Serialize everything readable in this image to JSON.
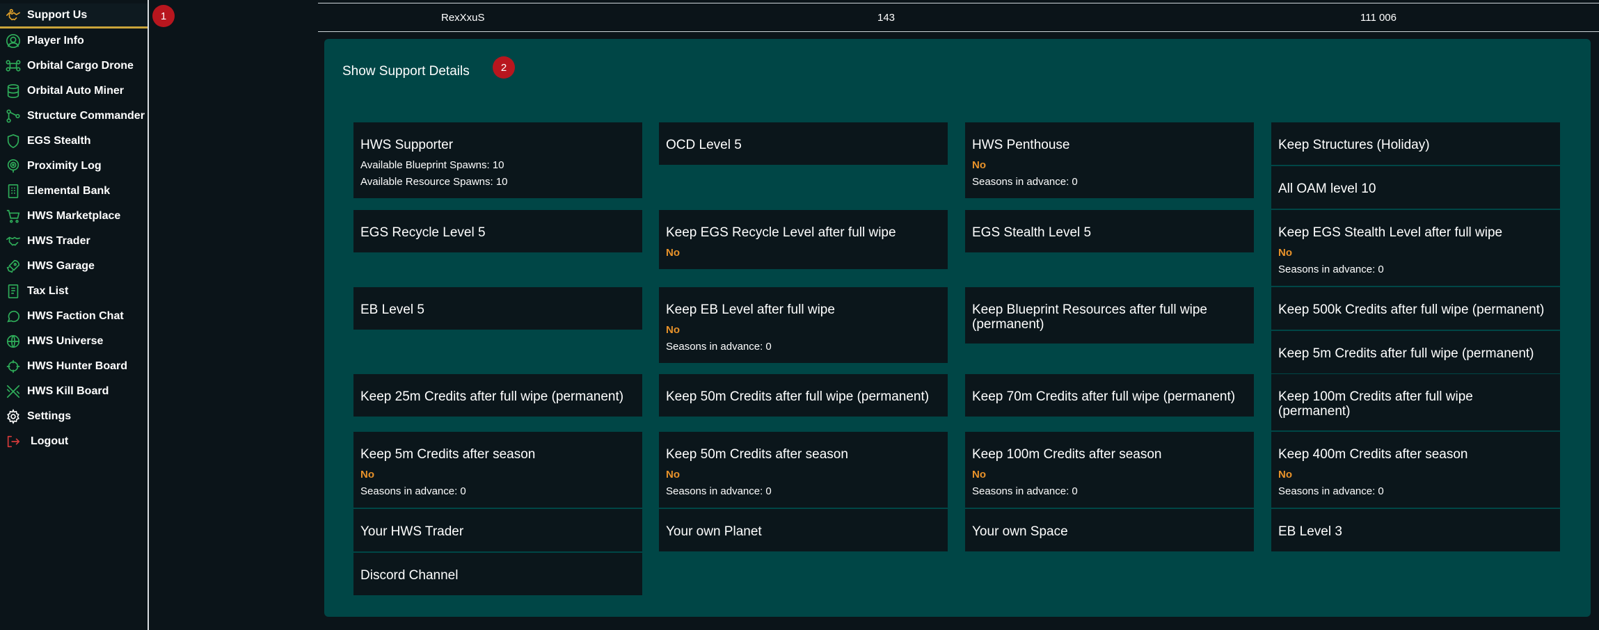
{
  "sidebar": {
    "items": [
      {
        "label": "Support Us",
        "icon": "handshake-icon"
      },
      {
        "label": "Player Info",
        "icon": "user-icon"
      },
      {
        "label": "Orbital Cargo Drone",
        "icon": "drone-icon"
      },
      {
        "label": "Orbital Auto Miner",
        "icon": "database-icon"
      },
      {
        "label": "Structure Commander",
        "icon": "network-icon"
      },
      {
        "label": "EGS Stealth",
        "icon": "shield-icon"
      },
      {
        "label": "Proximity Log",
        "icon": "radar-icon"
      },
      {
        "label": "Elemental Bank",
        "icon": "bank-icon"
      },
      {
        "label": "HWS Marketplace",
        "icon": "cart-icon"
      },
      {
        "label": "HWS Trader",
        "icon": "handshake-icon"
      },
      {
        "label": "HWS Garage",
        "icon": "rocket-icon"
      },
      {
        "label": "Tax List",
        "icon": "document-icon"
      },
      {
        "label": "HWS Faction Chat",
        "icon": "chat-icon"
      },
      {
        "label": "HWS Universe",
        "icon": "globe-icon"
      },
      {
        "label": "HWS Hunter Board",
        "icon": "crosshair-icon"
      },
      {
        "label": "HWS Kill Board",
        "icon": "kill-icon"
      },
      {
        "label": "Settings",
        "icon": "gear-icon"
      },
      {
        "label": "Logout",
        "icon": "logout-icon"
      }
    ]
  },
  "badges": {
    "one": "1",
    "two": "2"
  },
  "top_row": {
    "name": "RexXxuS",
    "number": "143",
    "amount": "111 006"
  },
  "panel": {
    "title": "Show Support Details",
    "cards": [
      {
        "title": "HWS Supporter",
        "line1": "Available Blueprint Spawns: 10",
        "line2": "Available Resource Spawns: 10"
      },
      {
        "title": "OCD Level 5"
      },
      {
        "title": "HWS Penthouse",
        "status": "No",
        "line2": "Seasons in advance: 0"
      },
      {
        "title": "Keep Structures (Holiday)"
      },
      {
        "title": "All OAM level 10"
      },
      {
        "title": "EGS Recycle Level 5"
      },
      {
        "title": "Keep EGS Recycle Level after full wipe",
        "status": "No"
      },
      {
        "title": "EGS Stealth Level 5"
      },
      {
        "title": "Keep EGS Stealth Level after full wipe",
        "status": "No",
        "line2": "Seasons in advance: 0"
      },
      {
        "title": "EB Level 5"
      },
      {
        "title": "Keep EB Level after full wipe",
        "status": "No",
        "line2": "Seasons in advance: 0"
      },
      {
        "title_a": "Keep Blueprint Resources after full wipe",
        "title_b": "(permanent)"
      },
      {
        "title": "Keep 500k Credits after full wipe (permanent)"
      },
      {
        "title": "Keep 5m Credits after full wipe (permanent)"
      },
      {
        "title": "Keep 25m Credits after full wipe (permanent)"
      },
      {
        "title": "Keep 50m Credits after full wipe (permanent)"
      },
      {
        "title": "Keep 70m Credits after full wipe (permanent)"
      },
      {
        "title_a": "Keep 100m Credits after full wipe",
        "title_b": "(permanent)"
      },
      {
        "title": "Keep 5m Credits after season",
        "status": "No",
        "line2": "Seasons in advance: 0"
      },
      {
        "title": "Keep 50m Credits after season",
        "status": "No",
        "line2": "Seasons in advance: 0"
      },
      {
        "title": "Keep 100m Credits after season",
        "status": "No",
        "line2": "Seasons in advance: 0"
      },
      {
        "title": "Keep 400m Credits after season",
        "status": "No",
        "line2": "Seasons in advance: 0"
      },
      {
        "title": "Your HWS Trader"
      },
      {
        "title": "Your own Planet"
      },
      {
        "title": "Your own Space"
      },
      {
        "title": "EB Level 3"
      },
      {
        "title": "Discord Channel"
      }
    ]
  },
  "colors": {
    "panel_bg": "#004646",
    "card_bg": "#0b161b",
    "status_no": "#e8922a",
    "accent_gold": "#c9a43a",
    "icon_green": "#2fae5a",
    "logout_red": "#d63a3a",
    "badge_red": "#b8161e"
  }
}
